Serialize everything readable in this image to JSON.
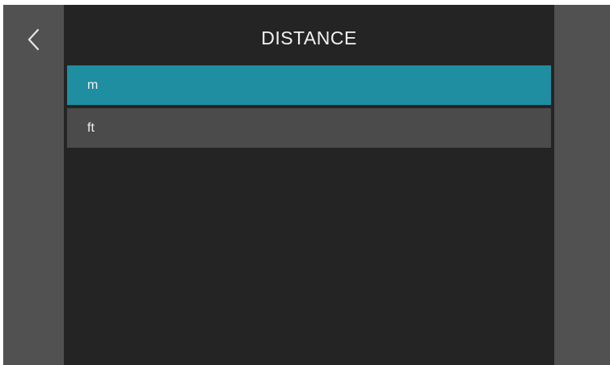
{
  "header": {
    "title": "DISTANCE",
    "back_icon": "chevron-left-icon"
  },
  "options": [
    {
      "label": "m",
      "selected": true
    },
    {
      "label": "ft",
      "selected": false
    }
  ],
  "colors": {
    "background": "#242424",
    "side_rail": "#515151",
    "option_bg": "#4b4b4b",
    "selected_bg": "#1f8ea1",
    "text": "#f0f0f0"
  }
}
